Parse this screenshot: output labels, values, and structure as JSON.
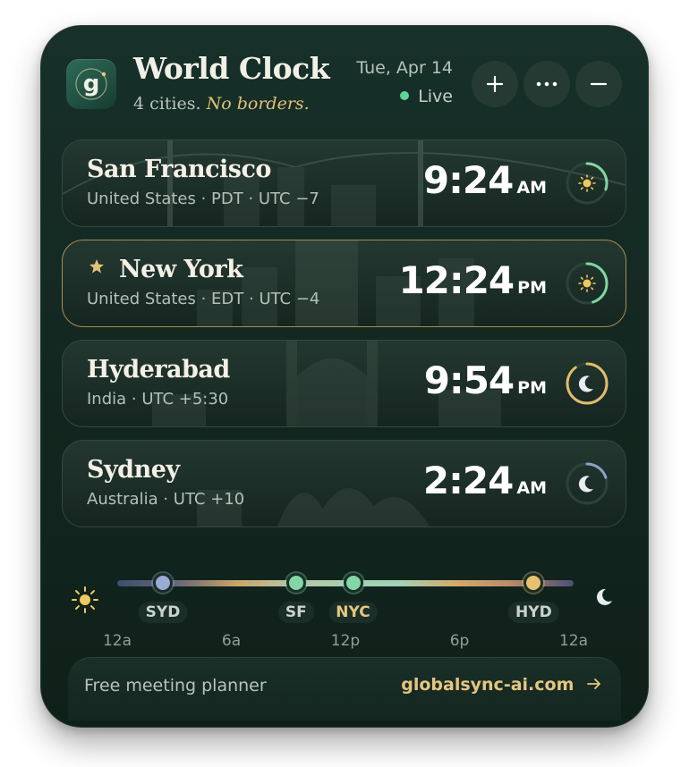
{
  "header": {
    "title": "World Clock",
    "subtitle_plain": "4 cities.",
    "subtitle_emphasis": "No borders.",
    "date": "Tue, Apr 14",
    "live_label": "Live"
  },
  "colors": {
    "background": "#12261f",
    "accent_gold": "#e1c176",
    "live_green": "#5ed49a",
    "day_ring": "#7fd6a3",
    "night_ring_hyd": "#e3bc6c",
    "night_ring_syd": "#8ea0c4"
  },
  "icons": [
    "logo-g-icon",
    "plus-icon",
    "more-icon",
    "minus-icon",
    "star-icon",
    "sun-icon",
    "moon-icon",
    "arrow-right-icon"
  ],
  "cities": [
    {
      "name": "San Francisco",
      "meta": "United States · PDT · UTC −7",
      "time": "9:24",
      "ampm": "AM",
      "period": "day",
      "favorite": false,
      "day_progress": 0.3
    },
    {
      "name": "New York",
      "meta": "United States · EDT · UTC −4",
      "time": "12:24",
      "ampm": "PM",
      "period": "day",
      "favorite": true,
      "day_progress": 0.45
    },
    {
      "name": "Hyderabad",
      "meta": "India · UTC +5:30",
      "time": "9:54",
      "ampm": "PM",
      "period": "night",
      "favorite": false,
      "day_progress": 0.9
    },
    {
      "name": "Sydney",
      "meta": "Australia · UTC +10",
      "time": "2:24",
      "ampm": "AM",
      "period": "night",
      "favorite": false,
      "day_progress": 0.2
    }
  ],
  "timeline": {
    "markers": [
      {
        "label": "SYD",
        "hour": 2.4,
        "color": "#9aabd6"
      },
      {
        "label": "SF",
        "hour": 9.4,
        "color": "#83d7a7"
      },
      {
        "label": "NYC",
        "hour": 12.4,
        "color": "#83d7a7"
      },
      {
        "label": "HYD",
        "hour": 21.9,
        "color": "#e6c26f"
      }
    ],
    "highlight": "NYC",
    "ticks": [
      "12a",
      "6a",
      "12p",
      "6p",
      "12a"
    ]
  },
  "footer": {
    "text": "Free meeting planner",
    "link": "globalsync-ai.com"
  }
}
